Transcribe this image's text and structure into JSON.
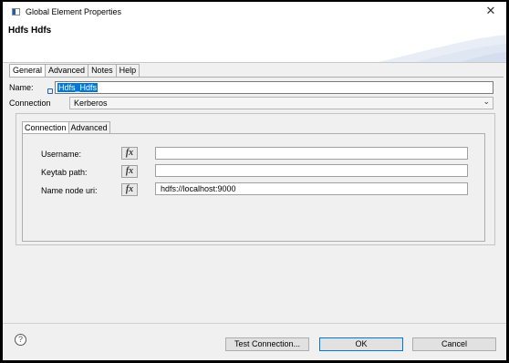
{
  "window": {
    "title": "Global Element Properties",
    "close_glyph": "✕"
  },
  "banner": {
    "title": "Hdfs Hdfs"
  },
  "tabs": [
    {
      "label": "General",
      "active": true
    },
    {
      "label": "Advanced",
      "active": false
    },
    {
      "label": "Notes",
      "active": false
    },
    {
      "label": "Help",
      "active": false
    }
  ],
  "general": {
    "name_label": "Name:",
    "name_value": "Hdfs_Hdfs",
    "connection_label": "Connection",
    "connection_value": "Kerberos",
    "chevron_glyph": "⌄"
  },
  "connection_tabs": [
    {
      "label": "Connection",
      "active": true
    },
    {
      "label": "Advanced",
      "active": false
    }
  ],
  "fields": [
    {
      "label": "Username:",
      "fx": "fx",
      "value": ""
    },
    {
      "label": "Keytab path:",
      "fx": "fx",
      "value": ""
    },
    {
      "label": "Name node uri:",
      "fx": "fx",
      "value": "hdfs://localhost:9000"
    }
  ],
  "footer": {
    "help_glyph": "?",
    "test_connection_label": "Test Connection...",
    "ok_label": "OK",
    "cancel_label": "Cancel"
  },
  "colors": {
    "selection": "#0078d7",
    "dialog_bg": "#f0f0f0",
    "frame": "#000000"
  }
}
